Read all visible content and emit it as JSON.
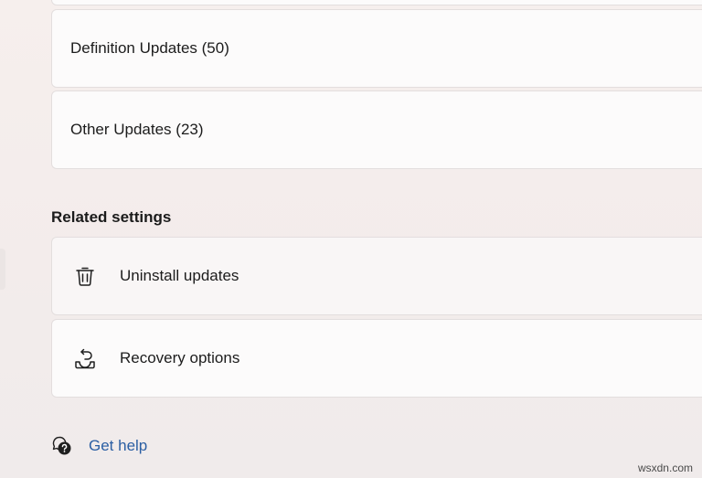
{
  "update_history": {
    "items": [
      {
        "label": "Definition Updates (50)"
      },
      {
        "label": "Other Updates (23)"
      }
    ]
  },
  "related_settings": {
    "heading": "Related settings",
    "items": [
      {
        "label": "Uninstall updates",
        "icon": "trash-icon"
      },
      {
        "label": "Recovery options",
        "icon": "recovery-icon"
      }
    ]
  },
  "help": {
    "label": "Get help",
    "icon": "help-icon",
    "link_color": "#2a5ea3"
  },
  "watermark": "wsxdn.com"
}
